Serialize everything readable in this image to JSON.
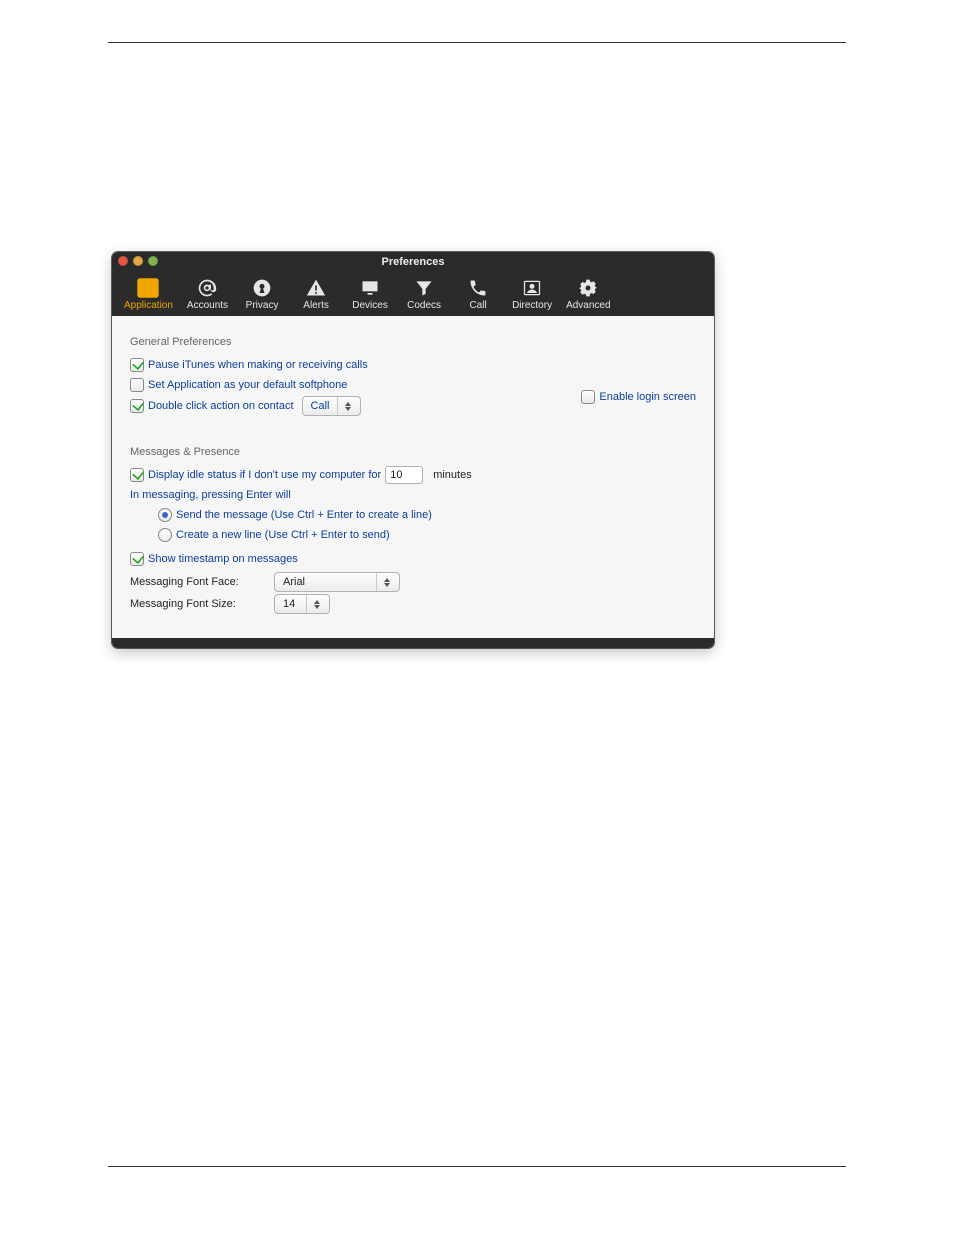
{
  "window": {
    "title": "Preferences"
  },
  "tabs": [
    {
      "id": "application",
      "label": "Application",
      "active": true
    },
    {
      "id": "accounts",
      "label": "Accounts",
      "active": false
    },
    {
      "id": "privacy",
      "label": "Privacy",
      "active": false
    },
    {
      "id": "alerts",
      "label": "Alerts",
      "active": false
    },
    {
      "id": "devices",
      "label": "Devices",
      "active": false
    },
    {
      "id": "codecs",
      "label": "Codecs",
      "active": false
    },
    {
      "id": "call",
      "label": "Call",
      "active": false
    },
    {
      "id": "directory",
      "label": "Directory",
      "active": false
    },
    {
      "id": "advanced",
      "label": "Advanced",
      "active": false
    }
  ],
  "general": {
    "heading": "General Preferences",
    "pause_itunes": {
      "label": "Pause iTunes when making or receiving calls",
      "checked": true
    },
    "default_softphone": {
      "label": "Set Application as your default softphone",
      "checked": false
    },
    "double_click": {
      "label": "Double click action on contact",
      "checked": true,
      "value": "Call"
    },
    "enable_login": {
      "label": "Enable login screen",
      "checked": false
    }
  },
  "messages": {
    "heading": "Messages & Presence",
    "idle": {
      "prefix": "Display idle status if I don't use my computer for",
      "value": "10",
      "suffix": "minutes",
      "checked": true
    },
    "enter_behavior": {
      "intro": "In messaging, pressing Enter will",
      "options": [
        {
          "label": "Send the message (Use Ctrl + Enter to create a line)",
          "selected": true
        },
        {
          "label": "Create a new line (Use Ctrl + Enter to send)",
          "selected": false
        }
      ]
    },
    "show_timestamp": {
      "label": "Show timestamp on messages",
      "checked": true
    },
    "font_face": {
      "label": "Messaging Font Face:",
      "value": "Arial"
    },
    "font_size": {
      "label": "Messaging Font Size:",
      "value": "14"
    }
  }
}
